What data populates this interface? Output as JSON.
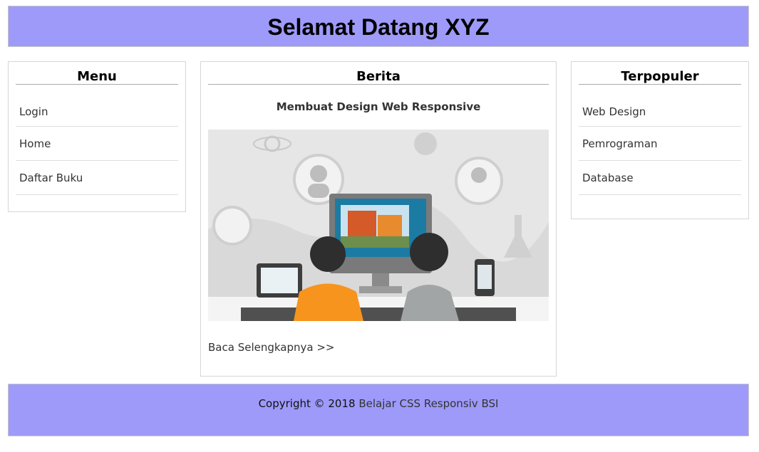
{
  "header": {
    "title": "Selamat Datang XYZ"
  },
  "menu": {
    "title": "Menu",
    "items": [
      {
        "label": "Login"
      },
      {
        "label": "Home"
      },
      {
        "label": "Daftar Buku"
      }
    ]
  },
  "news": {
    "title": "Berita",
    "article_title": "Membuat Design Web Responsive",
    "read_more": "Baca Selengkapnya >>"
  },
  "popular": {
    "title": "Terpopuler",
    "items": [
      {
        "label": "Web Design"
      },
      {
        "label": "Pemrograman"
      },
      {
        "label": "Database"
      }
    ]
  },
  "footer": {
    "prefix": "Copyright © 2018",
    "link": "Belajar CSS Responsiv BSI"
  },
  "colors": {
    "bar": "#9e9afa",
    "accent_orange": "#f7941d"
  }
}
